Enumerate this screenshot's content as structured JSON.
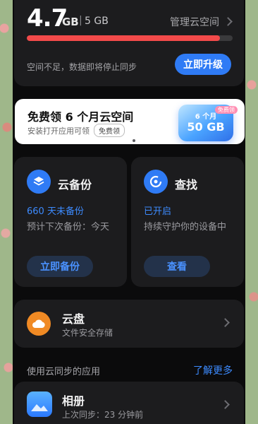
{
  "storage": {
    "used_value": "4.7",
    "used_unit": "GB",
    "separator": "|",
    "total": "5 GB",
    "manage_label": "管理云空间",
    "usage_percent": 94,
    "warning_text": "空间不足，数据即将停止同步",
    "upgrade_label": "立即升级",
    "colors": {
      "bar_fill": "#f24a4a",
      "upgrade_bg": "#2f7bf5"
    }
  },
  "promo": {
    "title": "免费领 6 个月云空间",
    "subtitle": "安装打开应用可领",
    "tag": "免费领",
    "box_line1": "6 个月",
    "box_line2": "50 GB",
    "box_badge": "免费领"
  },
  "backup": {
    "icon": "layers-icon",
    "name": "云备份",
    "status": "660 天未备份",
    "detail": "预计下次备份：今天",
    "button_label": "立即备份"
  },
  "find": {
    "icon": "locate-icon",
    "name": "查找",
    "status": "已开启",
    "detail": "持续守护你的设备中",
    "button_label": "查看"
  },
  "drive": {
    "icon": "cloud-icon",
    "name": "云盘",
    "subtitle": "文件安全存储"
  },
  "sync_apps": {
    "title": "使用云同步的应用",
    "more_label": "了解更多",
    "items": [
      {
        "icon": "gallery-icon",
        "name": "相册",
        "subtitle": "上次同步：23 分钟前"
      }
    ]
  }
}
